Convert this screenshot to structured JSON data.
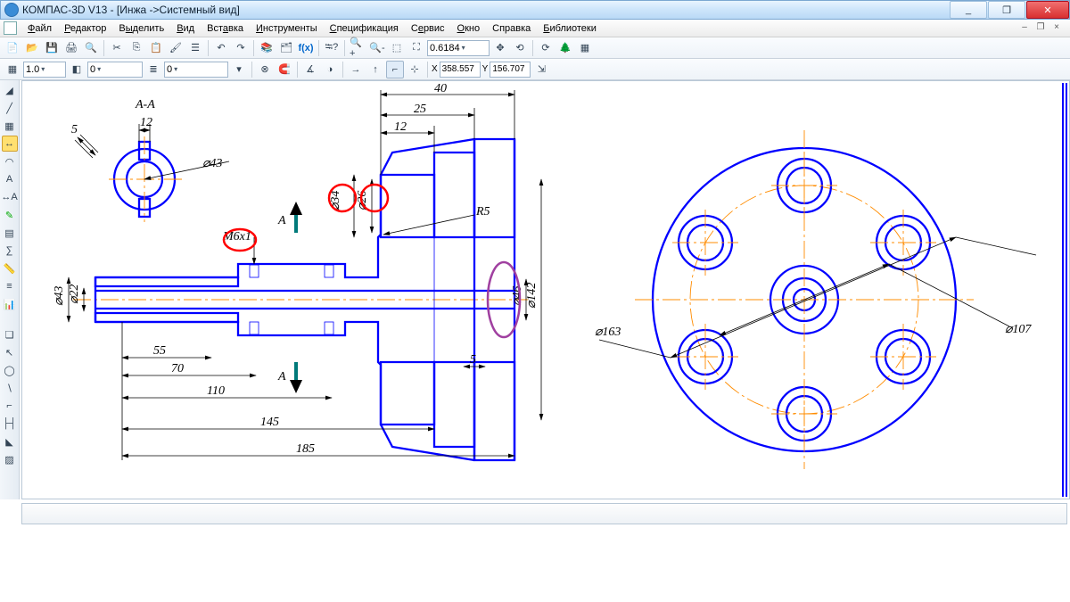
{
  "window": {
    "title": "КОМПАС-3D V13 - [Инжа ->Системный вид]",
    "buttons": {
      "min": "_",
      "max": "❐",
      "close": "✕"
    }
  },
  "menu": {
    "file": "Файл",
    "editor": "Редактор",
    "select": "Выделить",
    "view": "Вид",
    "insert": "Вставка",
    "tools": "Инструменты",
    "spec": "Спецификация",
    "service": "Сервис",
    "window": "Окно",
    "help": "Справка",
    "libs": "Библиотеки",
    "mdi": {
      "min": "–",
      "restore": "❐",
      "close": "×"
    }
  },
  "toolbar1": {
    "zoom": "0.6184",
    "fx": "f(x)"
  },
  "toolbar2": {
    "scale": "1.0",
    "state": "0",
    "layer": "0",
    "xlabel": "X",
    "ylabel": "Y",
    "xval": "358.557",
    "yval": "156.707"
  },
  "drawing": {
    "sectionLabel": "А-А",
    "markA1": "А",
    "markA2": "А",
    "dims": {
      "d5": "5",
      "d12a": "12",
      "phi43": "⌀43",
      "m6x1": "М6х1",
      "phi34": "⌀34",
      "phi26": "⌀26",
      "d40": "40",
      "d25": "25",
      "d12b": "12",
      "r5": "R5",
      "phi46": "⌀46",
      "phi142": "⌀142",
      "phi43b": "⌀43",
      "phi22": "⌀22",
      "d55": "55",
      "d70": "70",
      "d110": "110",
      "d145": "145",
      "d185": "185",
      "d5b": "5",
      "phi163": "⌀163",
      "phi107": "⌀107"
    }
  }
}
